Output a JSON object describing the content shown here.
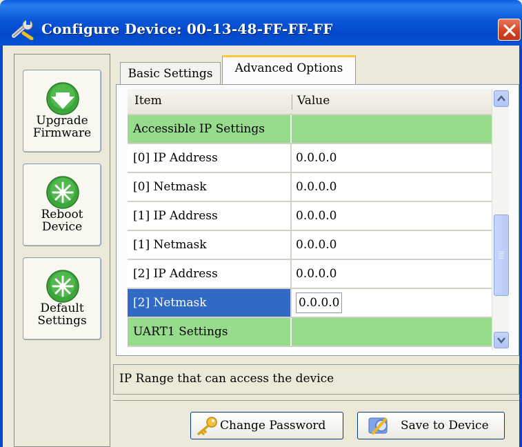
{
  "window": {
    "title": "Configure Device: 00-13-48-FF-FF-FF"
  },
  "sidebar": {
    "buttons": [
      {
        "label": "Upgrade\nFirmware",
        "icon": "download-arrow-icon"
      },
      {
        "label": "Reboot\nDevice",
        "icon": "reboot-icon"
      },
      {
        "label": "Default\nSettings",
        "icon": "default-settings-icon"
      }
    ]
  },
  "tabs": [
    {
      "label": "Basic Settings",
      "active": false
    },
    {
      "label": "Advanced Options",
      "active": true
    }
  ],
  "grid": {
    "columns": [
      "Item",
      "Value"
    ],
    "rows": [
      {
        "item": "Accessible IP Settings",
        "value": "",
        "type": "group"
      },
      {
        "item": "[0]  IP Address",
        "value": "0.0.0.0",
        "type": "item"
      },
      {
        "item": "[0]  Netmask",
        "value": "0.0.0.0",
        "type": "item"
      },
      {
        "item": "[1]  IP Address",
        "value": "0.0.0.0",
        "type": "item"
      },
      {
        "item": "[1]  Netmask",
        "value": "0.0.0.0",
        "type": "item"
      },
      {
        "item": "[2]  IP Address",
        "value": "0.0.0.0",
        "type": "item"
      },
      {
        "item": "[2]  Netmask",
        "value": "0.0.0.0",
        "type": "selected"
      },
      {
        "item": "UART1 Settings",
        "value": "",
        "type": "group"
      }
    ]
  },
  "description": "IP Range that can access the device",
  "buttons": {
    "change_password": "Change Password",
    "save_to_device": "Save to Device"
  },
  "colors": {
    "titlebar": "#0348c8",
    "group_row": "#96dc8c",
    "selection": "#316ac5",
    "active_tab_accent": "#ffc83c"
  }
}
